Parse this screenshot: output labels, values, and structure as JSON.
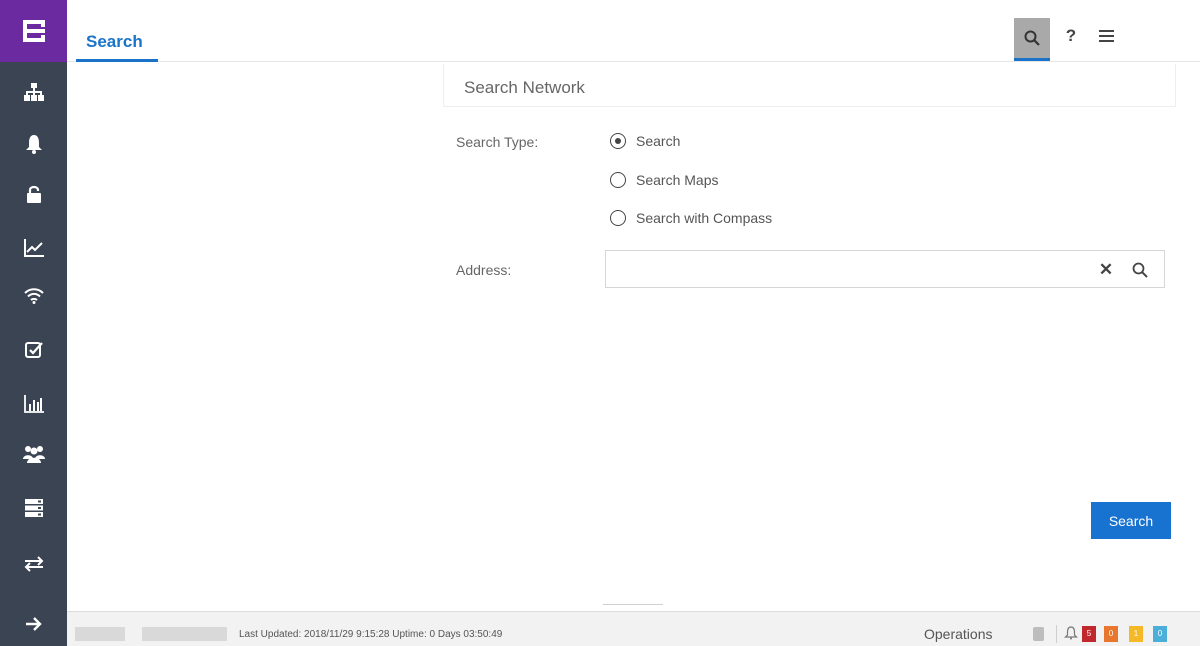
{
  "header": {
    "tab_label": "Search",
    "help_label": "?"
  },
  "sidebar": {
    "items": [
      {
        "icon": "topology-icon"
      },
      {
        "icon": "bell-icon"
      },
      {
        "icon": "unlock-icon"
      },
      {
        "icon": "line-chart-icon"
      },
      {
        "icon": "wifi-icon"
      },
      {
        "icon": "checkbox-icon"
      },
      {
        "icon": "bar-chart-icon"
      },
      {
        "icon": "users-icon"
      },
      {
        "icon": "server-icon"
      },
      {
        "icon": "swap-arrows-icon"
      },
      {
        "icon": "arrow-right-icon"
      }
    ]
  },
  "panel": {
    "title": "Search Network",
    "search_type_label": "Search Type:",
    "options": [
      "Search",
      "Search Maps",
      "Search with Compass"
    ],
    "selected_option": "Search",
    "address_label": "Address:",
    "address_value": "",
    "clear_symbol": "✕",
    "search_button": "Search"
  },
  "status": {
    "text": "Last Updated: 2018/11/29 9:15:28   Uptime: 0 Days 03:50:49",
    "operations": "Operations",
    "badges": [
      {
        "count": "5",
        "color": "#c0282e"
      },
      {
        "count": "0",
        "color": "#e8762c"
      },
      {
        "count": "1",
        "color": "#f5b928"
      },
      {
        "count": "0",
        "color": "#4ab0d9"
      }
    ]
  },
  "colors": {
    "accent": "#1a73c8",
    "sidebar": "#3b4452",
    "logo": "#6b2aa0"
  }
}
